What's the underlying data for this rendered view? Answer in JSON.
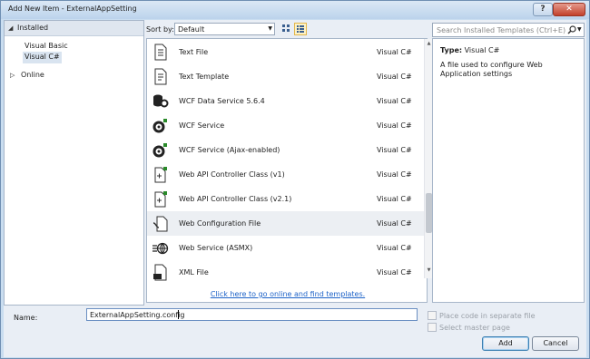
{
  "window": {
    "title": "Add New Item - ExternalAppSetting"
  },
  "titlebar": {
    "help_glyph": "?",
    "close_glyph": "✕"
  },
  "left_panel": {
    "installed": "Installed",
    "items": [
      "Visual Basic",
      "Visual C#"
    ],
    "online": "Online"
  },
  "sort": {
    "label": "Sort by:",
    "value": "Default"
  },
  "templates": [
    {
      "name": "Text File",
      "lang": "Visual C#",
      "icon": "text-file-icon"
    },
    {
      "name": "Text Template",
      "lang": "Visual C#",
      "icon": "text-template-icon"
    },
    {
      "name": "WCF Data Service 5.6.4",
      "lang": "Visual C#",
      "icon": "wcf-data-service-icon"
    },
    {
      "name": "WCF Service",
      "lang": "Visual C#",
      "icon": "wcf-service-icon"
    },
    {
      "name": "WCF Service (Ajax-enabled)",
      "lang": "Visual C#",
      "icon": "wcf-ajax-service-icon"
    },
    {
      "name": "Web API Controller Class (v1)",
      "lang": "Visual C#",
      "icon": "web-api-controller-icon"
    },
    {
      "name": "Web API Controller Class (v2.1)",
      "lang": "Visual C#",
      "icon": "web-api-controller-icon"
    },
    {
      "name": "Web Configuration File",
      "lang": "Visual C#",
      "icon": "web-config-icon"
    },
    {
      "name": "Web Service (ASMX)",
      "lang": "Visual C#",
      "icon": "web-service-icon"
    },
    {
      "name": "XML File",
      "lang": "Visual C#",
      "icon": "xml-file-icon"
    }
  ],
  "online_link": "Click here to go online and find templates.",
  "search": {
    "placeholder": "Search Installed Templates (Ctrl+E)"
  },
  "details": {
    "type_label": "Type:",
    "type_value": "Visual C#",
    "description": "A file used to configure Web Application settings"
  },
  "name": {
    "label": "Name:",
    "value": "ExternalAppSetting.config"
  },
  "options": {
    "place_code": "Place code in separate file",
    "select_master": "Select master page"
  },
  "buttons": {
    "add": "Add",
    "cancel": "Cancel"
  }
}
